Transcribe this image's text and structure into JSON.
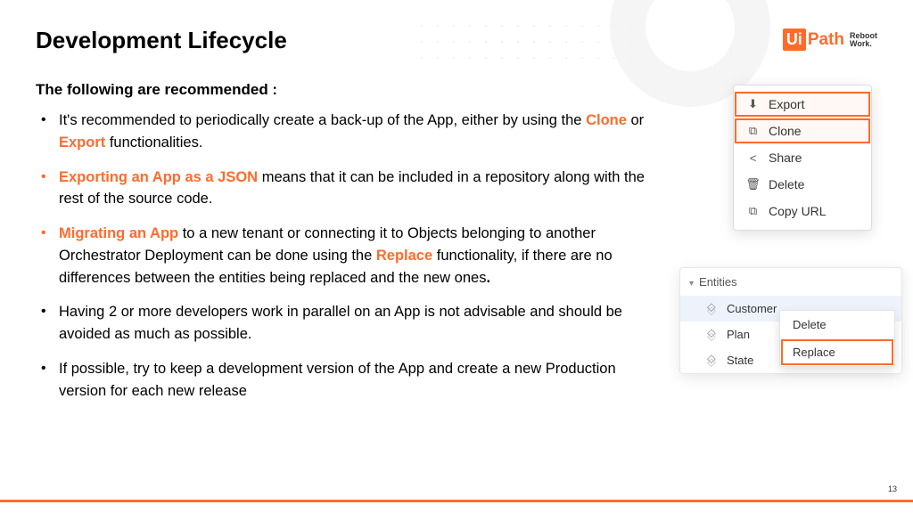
{
  "title": "Development Lifecycle",
  "subtitle": "The following are recommended :",
  "bullets": {
    "b1_a": "It's recommended to periodically create a back-up of the App, either by using the ",
    "b1_clone": "Clone",
    "b1_b": " or ",
    "b1_export": "Export",
    "b1_c": " functionalities.",
    "b2_a": "Exporting an App as a JSON",
    "b2_b": " means that it can be included in a repository along with the rest of the source code.",
    "b3_a": "Migrating an App",
    "b3_b": " to a new tenant or connecting it to Objects belonging to another Orchestrator Deployment can be done using the ",
    "b3_replace": "Replace",
    "b3_c": " functionality, if there are no differences between the entities being replaced and the new ones",
    "b3_d": ".",
    "b4": "Having 2 or more developers work in parallel on an App is not advisable and should be avoided as much as possible.",
    "b5": "If possible, try to keep a development version of the App and create a new Production version for each new release"
  },
  "menu1": {
    "export": "Export",
    "clone": "Clone",
    "share": "Share",
    "delete": "Delete",
    "copyurl": "Copy URL"
  },
  "entities": {
    "header": "Entities",
    "e1": "Customer",
    "e2": "Plan",
    "e3": "State"
  },
  "submenu": {
    "delete": "Delete",
    "replace": "Replace"
  },
  "logo": {
    "ui": "Ui",
    "path": "Path",
    "tag1": "Reboot",
    "tag2": "Work."
  },
  "page": "13"
}
